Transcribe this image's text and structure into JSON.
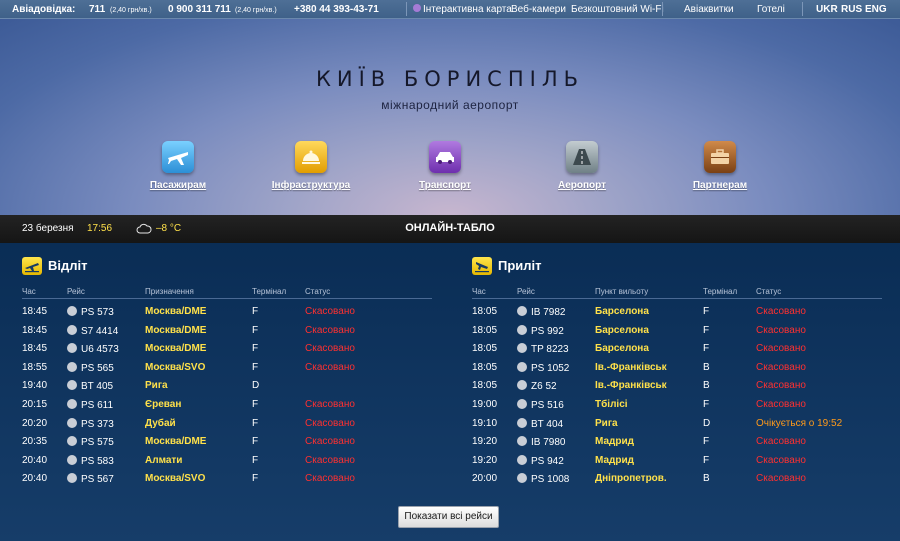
{
  "topbar": {
    "label": "Авіадовідка:",
    "phone1": "711",
    "phone1_price": "(2,40 грн/хв.)",
    "phone2": "0 900 311 711",
    "phone2_price": "(2,40 грн/хв.)",
    "phone3": "+380 44 393-43-71",
    "links": [
      "Інтерактивна карта",
      "Веб-камери",
      "Безкоштовний Wi-Fi",
      "Авіаквитки",
      "Готелі"
    ],
    "langs": [
      "UKR",
      "RUS",
      "ENG"
    ]
  },
  "hero": {
    "title": "КИЇВ БОРИСПІЛЬ",
    "subtitle": "міжнародний аеропорт",
    "nav": [
      {
        "label": "Пасажирам",
        "icon": "airplane-icon",
        "color": "#3aa6e6"
      },
      {
        "label": "Інфраструктура",
        "icon": "food-service-icon",
        "color": "#f1b31c"
      },
      {
        "label": "Транспорт",
        "icon": "car-icon",
        "color": "#8b4fc1"
      },
      {
        "label": "Аеропорт",
        "icon": "runway-icon",
        "color": "#8fa0a4"
      },
      {
        "label": "Партнерам",
        "icon": "briefcase-icon",
        "color": "#a8632c"
      }
    ]
  },
  "status": {
    "date": "23 березня",
    "time": "17:56",
    "temperature": "–8 °С",
    "board_title": "ОНЛАЙН-ТАБЛО"
  },
  "departures": {
    "title": "Відліт",
    "columns": [
      "Час",
      "Рейс",
      "Призначення",
      "Термінал",
      "Статус"
    ],
    "rows": [
      {
        "time": "18:45",
        "flight": "PS 573",
        "city": "Москва/DME",
        "terminal": "F",
        "status": "Скасовано"
      },
      {
        "time": "18:45",
        "flight": "S7 4414",
        "city": "Москва/DME",
        "terminal": "F",
        "status": "Скасовано"
      },
      {
        "time": "18:45",
        "flight": "U6 4573",
        "city": "Москва/DME",
        "terminal": "F",
        "status": "Скасовано"
      },
      {
        "time": "18:55",
        "flight": "PS 565",
        "city": "Москва/SVO",
        "terminal": "F",
        "status": "Скасовано"
      },
      {
        "time": "19:40",
        "flight": "BT 405",
        "city": "Рига",
        "terminal": "D",
        "status": ""
      },
      {
        "time": "20:15",
        "flight": "PS 611",
        "city": "Єреван",
        "terminal": "F",
        "status": "Скасовано"
      },
      {
        "time": "20:20",
        "flight": "PS 373",
        "city": "Дубай",
        "terminal": "F",
        "status": "Скасовано"
      },
      {
        "time": "20:35",
        "flight": "PS 575",
        "city": "Москва/DME",
        "terminal": "F",
        "status": "Скасовано"
      },
      {
        "time": "20:40",
        "flight": "PS 583",
        "city": "Алмати",
        "terminal": "F",
        "status": "Скасовано"
      },
      {
        "time": "20:40",
        "flight": "PS 567",
        "city": "Москва/SVO",
        "terminal": "F",
        "status": "Скасовано"
      }
    ]
  },
  "arrivals": {
    "title": "Приліт",
    "columns": [
      "Час",
      "Рейс",
      "Пункт вильоту",
      "Термінал",
      "Статус"
    ],
    "rows": [
      {
        "time": "18:05",
        "flight": "IB 7982",
        "city": "Барселона",
        "terminal": "F",
        "status": "Скасовано"
      },
      {
        "time": "18:05",
        "flight": "PS 992",
        "city": "Барселона",
        "terminal": "F",
        "status": "Скасовано"
      },
      {
        "time": "18:05",
        "flight": "TP 8223",
        "city": "Барселона",
        "terminal": "F",
        "status": "Скасовано"
      },
      {
        "time": "18:05",
        "flight": "PS 1052",
        "city": "Ів.-Франківськ",
        "terminal": "B",
        "status": "Скасовано"
      },
      {
        "time": "18:05",
        "flight": "Z6 52",
        "city": "Ів.-Франківськ",
        "terminal": "B",
        "status": "Скасовано"
      },
      {
        "time": "19:00",
        "flight": "PS 516",
        "city": "Тбілісі",
        "terminal": "F",
        "status": "Скасовано"
      },
      {
        "time": "19:10",
        "flight": "BT 404",
        "city": "Рига",
        "terminal": "D",
        "status": "Очікується о 19:52",
        "status_type": "expected"
      },
      {
        "time": "19:20",
        "flight": "IB 7980",
        "city": "Мадрид",
        "terminal": "F",
        "status": "Скасовано"
      },
      {
        "time": "19:20",
        "flight": "PS 942",
        "city": "Мадрид",
        "terminal": "F",
        "status": "Скасовано"
      },
      {
        "time": "20:00",
        "flight": "PS 1008",
        "city": "Дніпропетров.",
        "terminal": "B",
        "status": "Скасовано"
      }
    ]
  },
  "show_all_label": "Показати всі рейси"
}
